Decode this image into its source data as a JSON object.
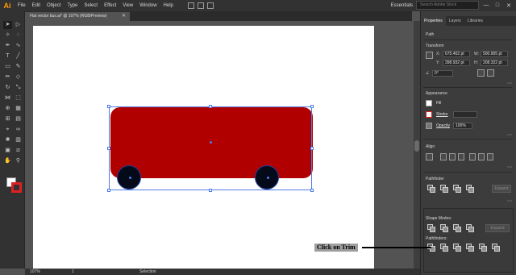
{
  "app": {
    "logo": "Ai"
  },
  "menu": [
    "File",
    "Edit",
    "Object",
    "Type",
    "Select",
    "Effect",
    "View",
    "Window",
    "Help"
  ],
  "menubar_right": {
    "workspace": "Essentials",
    "search_placeholder": "Search Adobe Stock",
    "minimize": "—",
    "maximize": "□",
    "close": "✕"
  },
  "document": {
    "tab_title": "Flat vector bus.ai* @ 107% (RGB/Preview)",
    "close": "✕"
  },
  "statusbar": {
    "zoom": "107%",
    "page": "1",
    "mode": "Selection"
  },
  "panel": {
    "tabs": [
      "Properties",
      "Layers",
      "Libraries"
    ],
    "path_label": "Path",
    "transform": {
      "title": "Transform",
      "x_label": "X:",
      "x_value": "675.402 pt",
      "y_label": "Y:",
      "y_value": "398.932 pt",
      "w_label": "W:",
      "w_value": "500.905 pt",
      "h_label": "H:",
      "h_value": "208.322 pt",
      "angle_value": "0°"
    },
    "appearance": {
      "title": "Appearance",
      "fill_label": "Fill",
      "stroke_label": "Stroke",
      "opacity_label": "Opacity",
      "opacity_value": "100%"
    },
    "align_title": "Align",
    "pathfinder": {
      "title": "Pathfinder",
      "expand_label": "Expand",
      "shape_modes_title": "Shape Modes:",
      "expand2_label": "Expand",
      "pathfinders_title": "Pathfinders:"
    }
  },
  "annotation": {
    "label": "Click on Trim"
  },
  "colors": {
    "bus": "#b00000",
    "wheel": "#040a1a",
    "selection": "#4f7be8",
    "stroke_swatch": "#e02020"
  }
}
